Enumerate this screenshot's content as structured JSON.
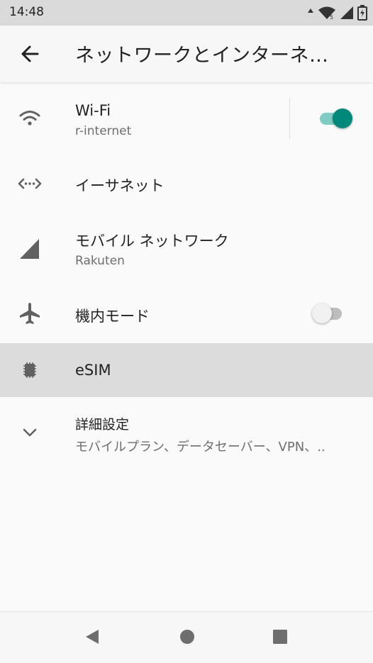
{
  "status_bar": {
    "time": "14:48",
    "icons": [
      "notification-arrow-icon",
      "wifi-icon",
      "signal-icon",
      "battery-icon"
    ]
  },
  "app_bar": {
    "title": "ネットワークとインターネ…",
    "back_icon": "arrow-back-icon"
  },
  "items": {
    "wifi": {
      "title": "Wi-Fi",
      "subtitle": "r-internet",
      "icon": "wifi-icon",
      "toggle_on": true
    },
    "ethernet": {
      "title": "イーサネット",
      "icon": "ethernet-icon"
    },
    "mobile": {
      "title": "モバイル ネットワーク",
      "subtitle": "Rakuten",
      "icon": "signal-icon"
    },
    "airplane": {
      "title": "機内モード",
      "icon": "airplane-icon",
      "toggle_on": false
    },
    "esim": {
      "title": "eSIM",
      "icon": "sim-card-icon",
      "highlighted": true
    },
    "advanced": {
      "title": "詳細設定",
      "subtitle": "モバイルプラン、データセーバー、VPN、..",
      "icon": "chevron-down-icon"
    }
  },
  "nav_bar": {
    "buttons": [
      "back-triangle-icon",
      "home-circle-icon",
      "recents-square-icon"
    ]
  },
  "colors": {
    "accent": "#00897b",
    "accent_track": "#80cbc4",
    "highlight": "#dcdcdc",
    "icon_gray": "#616161"
  }
}
